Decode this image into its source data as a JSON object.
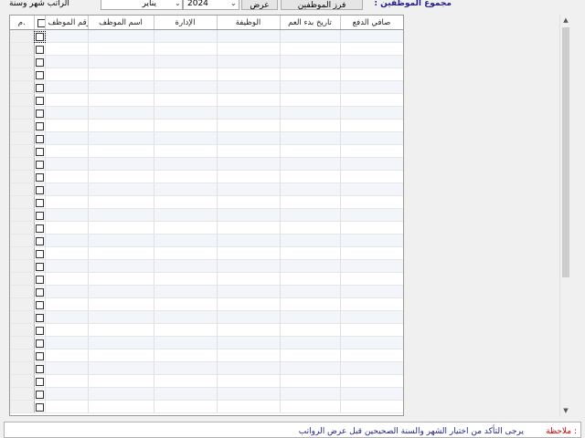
{
  "toolbar": {
    "period_label": "الراتب شهر وسنة",
    "month_value": "يناير",
    "year_value": "2024",
    "show_button": "عرض",
    "sort_button": "فرز الموظفين",
    "total_label": ": مجموع الموظفين"
  },
  "grid": {
    "columns": [
      "م.",
      "",
      "رقم الموظف",
      "اسم الموظف",
      "الإدارة",
      "الوظيفة",
      "تاريخ بدء العم",
      "صافي الدفع"
    ],
    "row_count": 30
  },
  "note": {
    "label": "ملاحظة :",
    "text": "يرجى التأكد من اختيار الشهر والسنة الصحيحين قبل عرض الرواتب"
  }
}
